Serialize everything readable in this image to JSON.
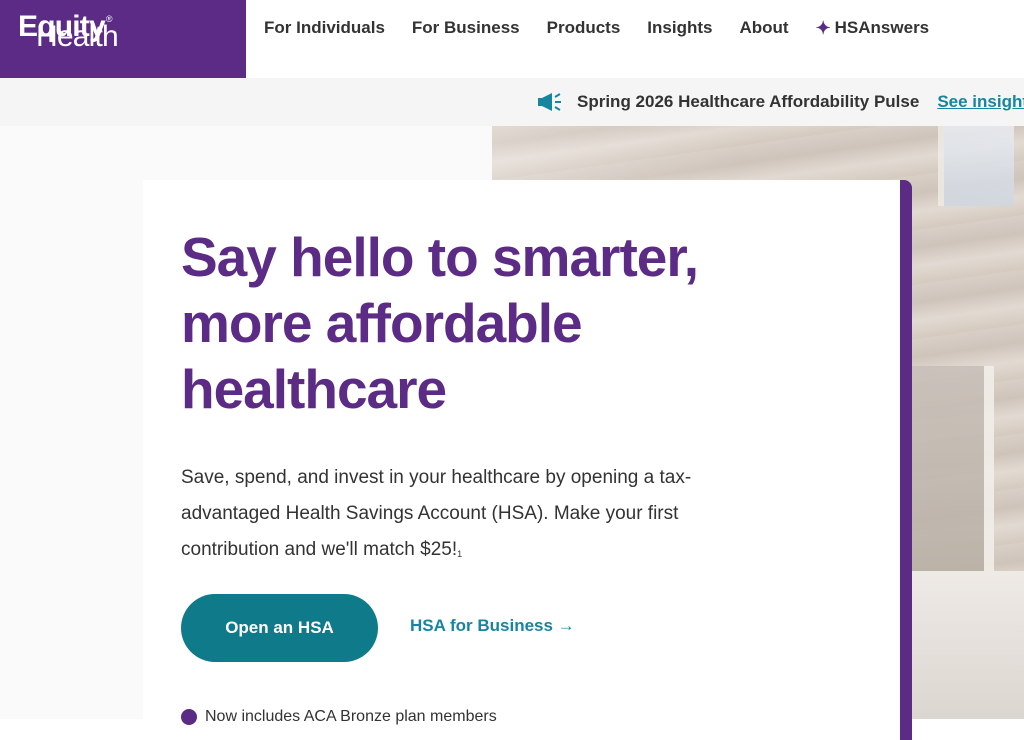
{
  "header": {
    "logo": {
      "light": "Health",
      "bold": "Equity",
      "reg": "®"
    },
    "nav": [
      "For Individuals",
      "For Business",
      "Products",
      "Insights",
      "About",
      "HSAnswers"
    ]
  },
  "announcement": {
    "icon": "megaphone-icon",
    "message": "Spring 2026 Healthcare Affordability Pulse",
    "link": "See insights"
  },
  "hero": {
    "headline": "Say hello to smarter, more affordable healthcare",
    "body": "Save, spend, and invest in your healthcare by opening a tax-advantaged Health Savings Account (HSA). Make your first contribution and we'll match $25!",
    "footnote_marker": "1",
    "primary_cta": "Open an HSA",
    "secondary_cta": "HSA for Business →",
    "note": "Now includes ACA Bronze plan members"
  },
  "colors": {
    "brand_purple": "#5b2b86",
    "teal_button": "#0f7a8a",
    "link_teal": "#1785a0"
  }
}
